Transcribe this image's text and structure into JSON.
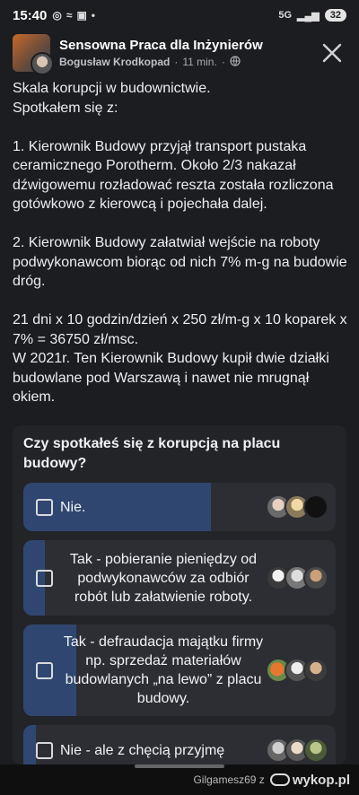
{
  "status": {
    "time": "15:40",
    "left_icons": [
      "instagram-icon",
      "signal-waves-icon",
      "image-icon",
      "dot-icon"
    ],
    "network": "5G",
    "battery": "32"
  },
  "header": {
    "group_title": "Sensowna Praca dla Inżynierów",
    "author": "Bogusław Krodkopad",
    "separator": "·",
    "time_ago": "11 min.",
    "privacy_icon": "globe-icon",
    "close_icon": "close-icon"
  },
  "post": {
    "text": "Skala korupcji w budownictwie.\nSpotkałem się z:\n\n1. Kierownik Budowy przyjął transport pustaka ceramicznego Porotherm. Około 2/3 nakazał dźwigowemu rozładować reszta została rozliczona gotówkowo z kierowcą i pojechała dalej.\n\n2. Kierownik Budowy załatwiał wejście na roboty podwykonawcom biorąc od nich 7% m-g na budowie dróg.\n\n21 dni x 10 godzin/dzień x 250 zł/m-g x 10 koparek x 7% = 36750 zł/msc.\nW 2021r. Ten Kierownik Budowy kupił dwie działki budowlane pod Warszawą i nawet nie mrugnął okiem."
  },
  "poll": {
    "question": "Czy spotkałeś się z korupcją na placu budowy?",
    "options": [
      {
        "label": "Nie.",
        "fill_fraction": 0.6
      },
      {
        "label": "Tak - pobieranie pieniędzy od podwykonawców za odbiór robót lub załatwienie roboty.",
        "fill_fraction": 0.07
      },
      {
        "label": "Tak - defraudacja majątku firmy np. sprzedaż materiałów budowlanych „na lewo” z placu budowy.",
        "fill_fraction": 0.17
      },
      {
        "label": "Nie - ale z chęcią przyjmę",
        "fill_fraction": 0.04
      }
    ]
  },
  "footer": {
    "source": "Gilgamesz69  z",
    "brand": "wykop.pl"
  }
}
